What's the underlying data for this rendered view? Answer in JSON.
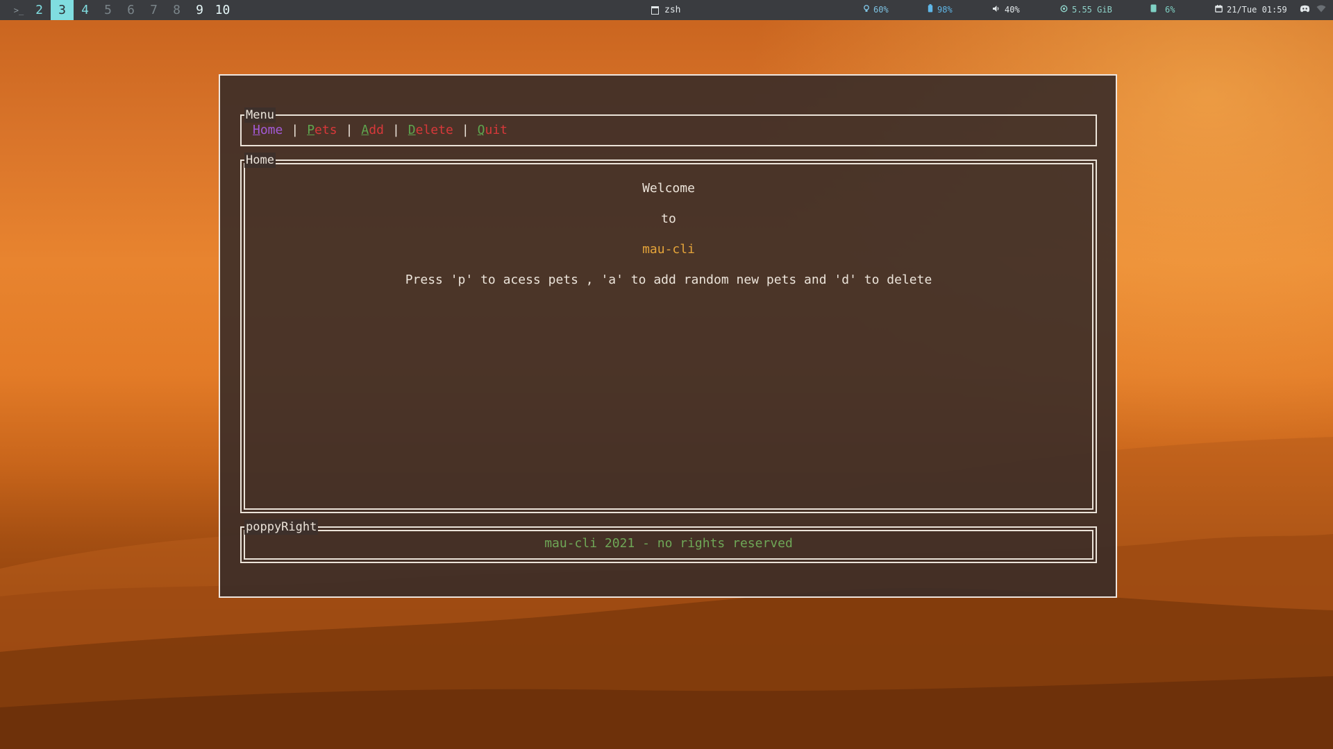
{
  "topbar": {
    "prompt_glyph": ">_",
    "workspaces": [
      {
        "label": "2",
        "state": "normal"
      },
      {
        "label": "3",
        "state": "active"
      },
      {
        "label": "4",
        "state": "normal"
      },
      {
        "label": "5",
        "state": "dim"
      },
      {
        "label": "6",
        "state": "dim"
      },
      {
        "label": "7",
        "state": "dim"
      },
      {
        "label": "8",
        "state": "dim"
      },
      {
        "label": "9",
        "state": "bright"
      },
      {
        "label": "10",
        "state": "bright"
      }
    ],
    "window_title": "zsh",
    "status": {
      "brightness": "60%",
      "battery": "98%",
      "volume": "40%",
      "memory": "5.55 GiB",
      "cpu": "6%",
      "datetime": "21/Tue 01:59"
    },
    "colors": {
      "bar_bg": "#3a3c40",
      "ws_accent": "#80dde0",
      "brightness": "#7ec3e3",
      "battery": "#5fb7e8",
      "volume": "#e3e8ea",
      "memory": "#8fd3c9",
      "cpu": "#7fd1c4",
      "datetime": "#e3e8ea"
    },
    "icons": {
      "brightness": "lightbulb-icon",
      "battery": "battery-icon",
      "volume": "speaker-icon",
      "memory": "memory-icon",
      "cpu": "cpu-icon",
      "datetime": "calendar-icon",
      "tray1": "discord-icon",
      "tray2": "wifi-icon"
    }
  },
  "app": {
    "menu": {
      "title": "Menu",
      "items": [
        {
          "hot": "H",
          "rest": "ome",
          "color": "#a35ad6"
        },
        {
          "hot": "P",
          "rest": "ets",
          "color": "#d8383a"
        },
        {
          "hot": "A",
          "rest": "dd",
          "color": "#d8383a"
        },
        {
          "hot": "D",
          "rest": "elete",
          "color": "#d8383a"
        },
        {
          "hot": "Q",
          "rest": "uit",
          "color": "#d8383a"
        }
      ],
      "hotkey_color": "#5fa54f",
      "separator": "|"
    },
    "home": {
      "title": "Home",
      "welcome": "Welcome",
      "to": "to",
      "app_name": "mau-cli",
      "app_name_color": "#e5a43a",
      "instructions": "Press 'p' to acess pets , 'a' to add random new pets and 'd' to delete"
    },
    "footer": {
      "title": "poppyRight",
      "text": "mau-cli 2021 - no rights reserved",
      "text_color": "#6fa757"
    }
  }
}
